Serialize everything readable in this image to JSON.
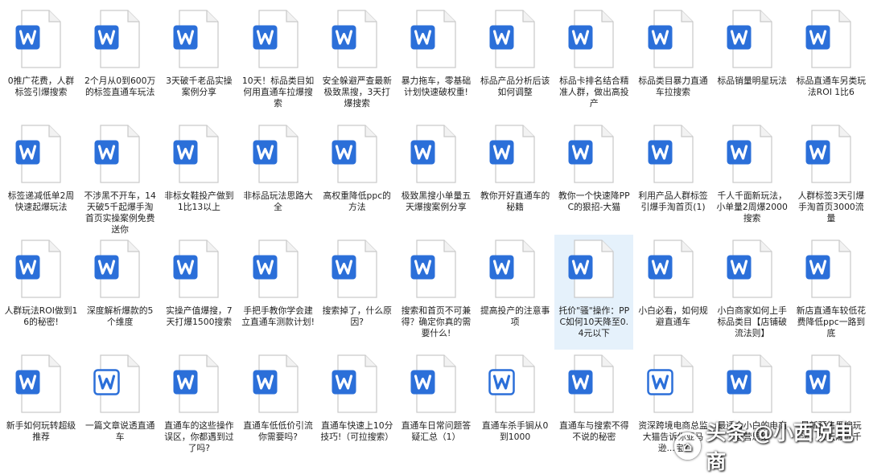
{
  "colors": {
    "doc_blue": "#2b6fd9",
    "doc_page": "#ffffff",
    "doc_border": "#c9c9c9",
    "selection": "#e5f1fb"
  },
  "files": [
    {
      "label": "0推广花费，人群标签引爆搜索",
      "icon": "word-doc-icon"
    },
    {
      "label": "2个月从0到600万的标签直通车玩法",
      "icon": "word-doc-icon"
    },
    {
      "label": "3天破千老品实操案例分享",
      "icon": "word-doc-icon"
    },
    {
      "label": "10天！标品类目如何用直通车拉爆搜索",
      "icon": "word-doc-icon"
    },
    {
      "label": "安全躲避严查最新极致黑搜，3天打爆搜索",
      "icon": "word-doc-icon"
    },
    {
      "label": "暴力拖车，零基础计划快速破权重!",
      "icon": "word-doc-icon"
    },
    {
      "label": "标品产品分析后该如何调整",
      "icon": "word-doc-icon"
    },
    {
      "label": "标品卡排名结合精准人群，做出高投产",
      "icon": "word-doc-icon"
    },
    {
      "label": "标品类目暴力直通车拉搜索",
      "icon": "word-doc-icon"
    },
    {
      "label": "标品销量明星玩法",
      "icon": "word-doc-icon"
    },
    {
      "label": "标品直通车另类玩法ROI 1比6",
      "icon": "word-doc-icon"
    },
    {
      "label": "标签递减低单2周快速起爆玩法",
      "icon": "word-doc-icon"
    },
    {
      "label": "不涉黑不开车，14天破5千起爆手淘首页实操案例免费送你",
      "icon": "word-doc-icon"
    },
    {
      "label": "非标女鞋投产做到1比13以上",
      "icon": "word-doc-icon"
    },
    {
      "label": "非标品玩法思路大全",
      "icon": "word-doc-icon"
    },
    {
      "label": "高权重降低ppc的方法",
      "icon": "word-doc-icon"
    },
    {
      "label": "极致黑搜小单量五天爆搜案例分享",
      "icon": "word-doc-icon"
    },
    {
      "label": "教你开好直通车的秘籍",
      "icon": "word-doc-icon"
    },
    {
      "label": "教你一个快速降PPC的狠招-大猫",
      "icon": "word-doc-icon"
    },
    {
      "label": "利用产品人群标签引爆手淘首页(1)",
      "icon": "word-doc-icon"
    },
    {
      "label": "千人千面新玩法，小单量2周爆2000搜索",
      "icon": "word-doc-icon"
    },
    {
      "label": "人群标签3天引爆手淘首页3000流量",
      "icon": "word-doc-icon"
    },
    {
      "label": "人群玩法ROI做到16的秘密!",
      "icon": "word-doc-icon"
    },
    {
      "label": "深度解析爆款的5个维度",
      "icon": "word-doc-icon"
    },
    {
      "label": "实操产值爆搜，7天打爆1500搜索",
      "icon": "word-doc-icon"
    },
    {
      "label": "手把手教你学会建立直通车测款计划!",
      "icon": "word-doc-icon"
    },
    {
      "label": "搜索掉了，什么原因?",
      "icon": "word-doc-icon"
    },
    {
      "label": "搜索和首页不可兼得？确定你真的需要什么!",
      "icon": "word-doc-icon"
    },
    {
      "label": "提高投产的注意事项",
      "icon": "word-doc-icon"
    },
    {
      "label": "托价\"骚\"操作：PPC如何10天降至0.4元以下",
      "icon": "word-doc-icon",
      "selected": true
    },
    {
      "label": "小白必看，如何规避直通车",
      "icon": "word-doc-icon"
    },
    {
      "label": "小白商家如何上手标品类目【店铺破流法则】",
      "icon": "word-doc-icon"
    },
    {
      "label": "新店直通车较低花费降低ppc一路到底",
      "icon": "word-doc-icon"
    },
    {
      "label": "新手如何玩转超级推荐",
      "icon": "word-doc-icon"
    },
    {
      "label": "一篇文章说透直通车",
      "icon": "word-doc-outline-icon"
    },
    {
      "label": "直通车的这些操作误区，你都遇到过了吗?",
      "icon": "word-doc-icon"
    },
    {
      "label": "直通车低低价引流你需要吗?",
      "icon": "word-doc-icon"
    },
    {
      "label": "直通车快速上10分技巧!（可拉搜索）",
      "icon": "word-doc-icon"
    },
    {
      "label": "直通车日常问题答疑汇总（1）",
      "icon": "word-doc-icon"
    },
    {
      "label": "直通车杀手锏从0到1000",
      "icon": "word-doc-outline-icon"
    },
    {
      "label": "直通车与搜索不得不说的秘密",
      "icon": "word-doc-icon"
    },
    {
      "label": "资深跨境电商总监大猫告诉你亚马逊...宝?",
      "icon": "word-doc-outline-icon"
    },
    {
      "label": "最适合小白的电商运营思维",
      "icon": "word-doc-icon"
    },
    {
      "label": "最新预售黑搜玩法，五天爆五千",
      "icon": "word-doc-icon"
    }
  ],
  "watermark": {
    "text": "头条 @小西说电商",
    "logo_glyph": "⌂"
  }
}
